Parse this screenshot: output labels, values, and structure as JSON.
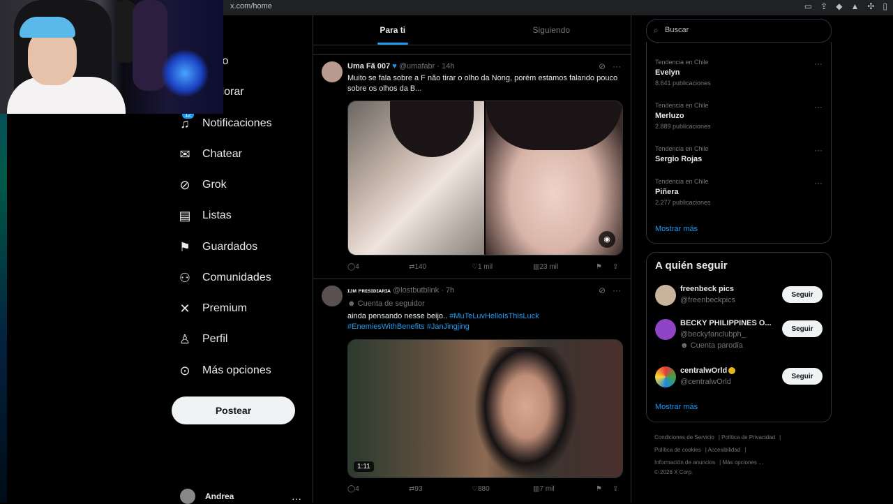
{
  "browser": {
    "url": "x.com/home"
  },
  "nav": {
    "items": [
      {
        "label": "Inicio",
        "icon": "home-icon"
      },
      {
        "label": "Explorar",
        "icon": "search-icon"
      },
      {
        "label": "Notificaciones",
        "icon": "bell-icon",
        "badge": "12"
      },
      {
        "label": "Chatear",
        "icon": "mail-icon"
      },
      {
        "label": "Grok",
        "icon": "grok-icon"
      },
      {
        "label": "Listas",
        "icon": "list-icon"
      },
      {
        "label": "Guardados",
        "icon": "bookmark-icon"
      },
      {
        "label": "Comunidades",
        "icon": "communities-icon"
      },
      {
        "label": "Premium",
        "icon": "x-logo-icon"
      },
      {
        "label": "Perfil",
        "icon": "person-icon"
      },
      {
        "label": "Más opciones",
        "icon": "more-circle-icon"
      }
    ],
    "post_button": "Postear",
    "account_name": "Andrea"
  },
  "feed": {
    "tabs": [
      {
        "label": "Para ti",
        "active": true
      },
      {
        "label": "Siguiendo",
        "active": false
      }
    ],
    "tweets": [
      {
        "name": "Uma Fã 007",
        "handle": "@umafabr",
        "time": "· 14h",
        "text": "Muito se fala sobre a F não tirar o olho da Nong, porém estamos falando pouco sobre os olhos da B...",
        "replies": "4",
        "reposts": "140",
        "likes": "1 mil",
        "views": "23 mil"
      },
      {
        "name": "ɪᴊᴍ ᴘʀᴇsɪᴅɪᴀʀɪᴀ",
        "handle": "@lostbutblink",
        "time": "· 7h",
        "sub": "Cuenta de seguidor",
        "text": "ainda pensando nesse beijo..",
        "hashtags_line1": "#MuTeLuvHelloIsThisLuck",
        "hashtags_line2": "#EnemiesWithBenefits #JanJingjing",
        "duration": "1:11",
        "replies": "4",
        "reposts": "93",
        "likes": "880",
        "views": "7 mil"
      }
    ]
  },
  "sidebar": {
    "search_placeholder": "Buscar",
    "trends": [
      {
        "category": "Tendencia en Chile",
        "name": "Evelyn",
        "count": "8.641 publicaciones"
      },
      {
        "category": "Tendencia en Chile",
        "name": "Merluzo",
        "count": "2.889 publicaciones"
      },
      {
        "category": "Tendencia en Chile",
        "name": "Sergio Rojas",
        "count": ""
      },
      {
        "category": "Tendencia en Chile",
        "name": "Piñera",
        "count": "2.277 publicaciones"
      }
    ],
    "trends_show_more": "Mostrar más",
    "who_to_follow": {
      "title": "A quién seguir",
      "accounts": [
        {
          "name": "freenbeck pics",
          "handle": "@freenbeckpics",
          "extra": "",
          "button": "Seguir"
        },
        {
          "name": "BECKY PHILIPPINES O...",
          "handle": "@beckyfanclubph_",
          "extra": "Cuenta parodia",
          "button": "Seguir"
        },
        {
          "name": "centralwOrld",
          "handle": "@centralwOrld",
          "extra": "",
          "button": "Seguir"
        }
      ],
      "show_more": "Mostrar más"
    },
    "footer": {
      "line1": [
        "Condiciones de Servicio",
        "Política de Privacidad"
      ],
      "line2": [
        "Política de cookies",
        "Accesibilidad"
      ],
      "line3": [
        "Información de anuncios",
        "Más opciones ..."
      ],
      "copyright": "© 2026 X Corp."
    }
  },
  "colors": {
    "accent": "#1d9bf0",
    "background": "#000000",
    "border": "#2f3336",
    "muted": "#71767b"
  }
}
